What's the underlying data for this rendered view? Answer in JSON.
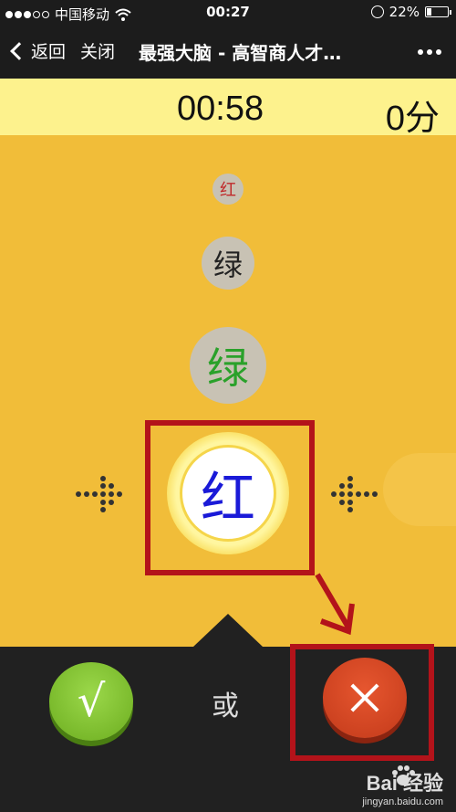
{
  "status": {
    "carrier": "中国移动",
    "time": "00:27",
    "battery": "22%",
    "battery_level": 0.22
  },
  "nav": {
    "back": "返回",
    "close": "关闭",
    "title": "最强大脑 - 高智商人才…"
  },
  "game": {
    "timer": "00:58",
    "score": "0分",
    "words": [
      {
        "text": "红",
        "color": "#c0282a"
      },
      {
        "text": "绿",
        "color": "#222222"
      },
      {
        "text": "绿",
        "color": "#2aa12a"
      },
      {
        "text": "红",
        "color": "#1a1ad8"
      }
    ]
  },
  "controls": {
    "yes_symbol": "√",
    "or": "或"
  },
  "watermark": {
    "brand": "Bai 经验",
    "url": "jingyan.baidu.com"
  },
  "colors": {
    "field": "#f1bd39",
    "header": "#fdf28d",
    "highlight": "#b3131a"
  }
}
